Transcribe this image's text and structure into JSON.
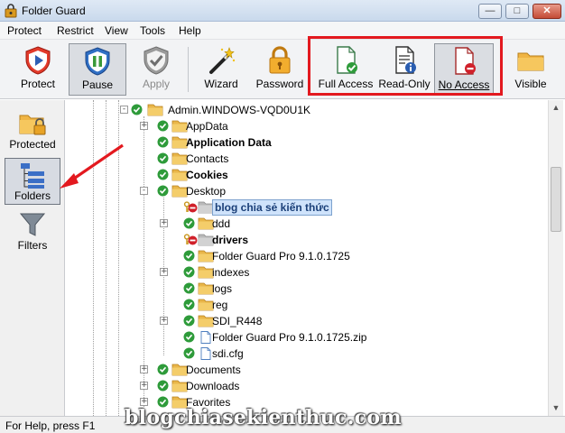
{
  "window": {
    "title": "Folder Guard"
  },
  "menu": [
    "Protect",
    "Restrict",
    "View",
    "Tools",
    "Help"
  ],
  "toolbar": {
    "buttons": [
      {
        "id": "protect",
        "label": "Protect"
      },
      {
        "id": "pause",
        "label": "Pause"
      },
      {
        "id": "apply",
        "label": "Apply"
      },
      {
        "id": "wizard",
        "label": "Wizard"
      },
      {
        "id": "password",
        "label": "Password"
      },
      {
        "id": "full_access",
        "label": "Full Access"
      },
      {
        "id": "read_only",
        "label": "Read-Only"
      },
      {
        "id": "no_access",
        "label": "No Access"
      },
      {
        "id": "visible",
        "label": "Visible"
      }
    ]
  },
  "left_nav": [
    {
      "id": "protected",
      "label": "Protected"
    },
    {
      "id": "folders",
      "label": "Folders"
    },
    {
      "id": "filters",
      "label": "Filters"
    }
  ],
  "tree": {
    "root": "Admin.WINDOWS-VQD0U1K",
    "items": [
      {
        "name": "AppData",
        "state": "ok",
        "type": "folder",
        "expander": "+",
        "bold": false
      },
      {
        "name": "Application Data",
        "state": "ok",
        "type": "folder",
        "expander": "",
        "bold": true
      },
      {
        "name": "Contacts",
        "state": "ok",
        "type": "folder",
        "expander": "",
        "bold": false
      },
      {
        "name": "Cookies",
        "state": "ok",
        "type": "folder",
        "expander": "",
        "bold": true
      },
      {
        "name": "Desktop",
        "state": "ok",
        "type": "folder",
        "expander": "-",
        "bold": false
      },
      {
        "name": "blog chia sẻ kiến thức",
        "state": "locked-deny",
        "type": "folder-gray",
        "expander": "",
        "bold": true,
        "selected": true
      },
      {
        "name": "ddd",
        "state": "ok",
        "type": "folder",
        "expander": "+",
        "bold": false
      },
      {
        "name": "drivers",
        "state": "locked-deny",
        "type": "folder-gray",
        "expander": "",
        "bold": true
      },
      {
        "name": "Folder Guard Pro 9.1.0.1725",
        "state": "ok",
        "type": "folder",
        "expander": "",
        "bold": false
      },
      {
        "name": "indexes",
        "state": "ok",
        "type": "folder",
        "expander": "+",
        "bold": false
      },
      {
        "name": "logs",
        "state": "ok",
        "type": "folder",
        "expander": "",
        "bold": false
      },
      {
        "name": "reg",
        "state": "ok",
        "type": "folder",
        "expander": "",
        "bold": false
      },
      {
        "name": "SDI_R448",
        "state": "ok",
        "type": "folder",
        "expander": "+",
        "bold": false
      },
      {
        "name": "Folder Guard Pro 9.1.0.1725.zip",
        "state": "ok",
        "type": "file",
        "expander": "",
        "bold": false
      },
      {
        "name": "sdi.cfg",
        "state": "ok",
        "type": "file",
        "expander": "",
        "bold": false
      },
      {
        "name": "Documents",
        "state": "ok",
        "type": "folder",
        "expander": "+",
        "bold": false
      },
      {
        "name": "Downloads",
        "state": "ok",
        "type": "folder",
        "expander": "+",
        "bold": false
      },
      {
        "name": "Favorites",
        "state": "ok",
        "type": "folder",
        "expander": "+",
        "bold": false
      }
    ]
  },
  "status": {
    "text": "For Help, press F1"
  },
  "watermark": "blogchiasekienthuc.com",
  "colors": {
    "highlight_box": "#e3191f",
    "ok_green": "#2e9b3a",
    "deny_red": "#d0202a",
    "folder_yellow": "#f2c04c"
  }
}
